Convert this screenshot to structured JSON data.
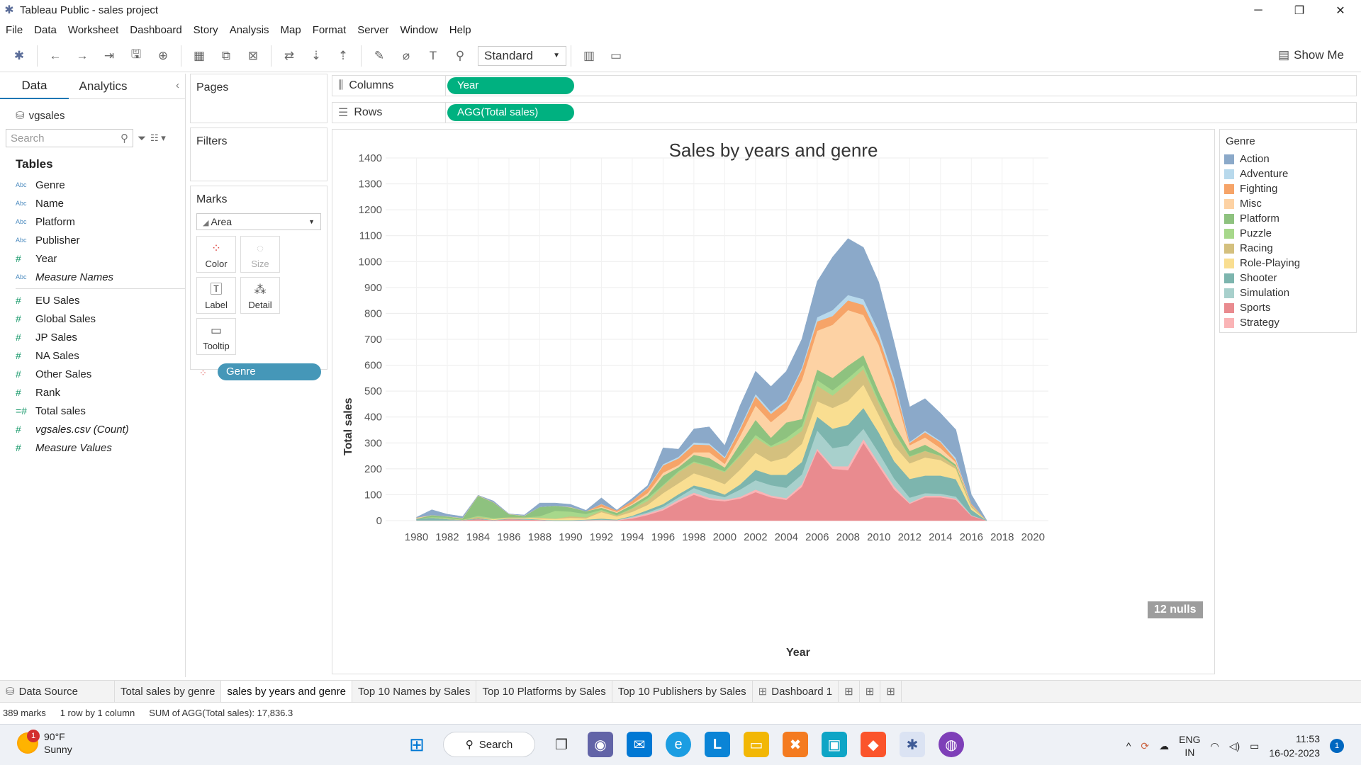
{
  "window": {
    "title": "Tableau Public - sales project"
  },
  "menu": [
    "File",
    "Data",
    "Worksheet",
    "Dashboard",
    "Story",
    "Analysis",
    "Map",
    "Format",
    "Server",
    "Window",
    "Help"
  ],
  "toolbar": {
    "fit_select": "Standard",
    "show_me": "Show Me"
  },
  "data_pane": {
    "tab_data": "Data",
    "tab_analytics": "Analytics",
    "datasource": "vgsales",
    "search_placeholder": "Search",
    "tables_title": "Tables",
    "dimensions": [
      {
        "type": "Abc",
        "name": "Genre",
        "italic": false
      },
      {
        "type": "Abc",
        "name": "Name",
        "italic": false
      },
      {
        "type": "Abc",
        "name": "Platform",
        "italic": false
      },
      {
        "type": "Abc",
        "name": "Publisher",
        "italic": false
      },
      {
        "type": "#",
        "name": "Year",
        "italic": false
      },
      {
        "type": "Abc",
        "name": "Measure Names",
        "italic": true
      }
    ],
    "measures": [
      {
        "type": "#",
        "name": "EU Sales",
        "italic": false
      },
      {
        "type": "#",
        "name": "Global Sales",
        "italic": false
      },
      {
        "type": "#",
        "name": "JP Sales",
        "italic": false
      },
      {
        "type": "#",
        "name": "NA Sales",
        "italic": false
      },
      {
        "type": "#",
        "name": "Other Sales",
        "italic": false
      },
      {
        "type": "#",
        "name": "Rank",
        "italic": false
      },
      {
        "type": "=#",
        "name": "Total sales",
        "italic": false
      },
      {
        "type": "#",
        "name": "vgsales.csv (Count)",
        "italic": true
      },
      {
        "type": "#",
        "name": "Measure Values",
        "italic": true
      }
    ]
  },
  "shelves": {
    "pages": "Pages",
    "filters": "Filters",
    "marks": "Marks",
    "mark_type": "Area",
    "mark_buttons": [
      "Color",
      "Size",
      "Label",
      "Detail",
      "Tooltip"
    ],
    "color_pill": "Genre",
    "columns_label": "Columns",
    "columns_pill": "Year",
    "rows_label": "Rows",
    "rows_pill": "AGG(Total sales)"
  },
  "chart_data": {
    "type": "area",
    "title": "Sales by years and genre",
    "xlabel": "Year",
    "ylabel": "Total sales",
    "xlim": [
      1978,
      2021
    ],
    "ylim": [
      0,
      1400
    ],
    "x_ticks": [
      1980,
      1982,
      1984,
      1986,
      1988,
      1990,
      1992,
      1994,
      1996,
      1998,
      2000,
      2002,
      2004,
      2006,
      2008,
      2010,
      2012,
      2014,
      2016,
      2018,
      2020
    ],
    "y_ticks": [
      0,
      100,
      200,
      300,
      400,
      500,
      600,
      700,
      800,
      900,
      1000,
      1100,
      1200,
      1300,
      1400
    ],
    "grid": true,
    "legend": "right",
    "stacked": true,
    "x": [
      1980,
      1981,
      1982,
      1983,
      1984,
      1985,
      1986,
      1987,
      1988,
      1989,
      1990,
      1991,
      1992,
      1993,
      1994,
      1995,
      1996,
      1997,
      1998,
      1999,
      2000,
      2001,
      2002,
      2003,
      2004,
      2005,
      2006,
      2007,
      2008,
      2009,
      2010,
      2011,
      2012,
      2013,
      2014,
      2015,
      2016,
      2017
    ],
    "series": [
      {
        "name": "Sports",
        "color": "#e98b8f",
        "values": [
          1,
          1,
          1,
          2,
          6,
          2,
          6,
          4,
          3,
          0,
          0,
          1,
          1,
          1,
          8,
          22,
          40,
          72,
          100,
          80,
          75,
          85,
          110,
          90,
          80,
          130,
          270,
          200,
          195,
          300,
          210,
          120,
          65,
          90,
          90,
          80,
          18,
          0
        ]
      },
      {
        "name": "Strategy",
        "color": "#fab4b6",
        "values": [
          0,
          0,
          0,
          0,
          0,
          0,
          0,
          0,
          0,
          0,
          0,
          1,
          1,
          1,
          4,
          6,
          6,
          8,
          8,
          8,
          6,
          7,
          10,
          7,
          7,
          10,
          8,
          10,
          15,
          15,
          12,
          12,
          4,
          6,
          6,
          5,
          2,
          0
        ]
      },
      {
        "name": "Simulation",
        "color": "#a8d0cc",
        "values": [
          0,
          0,
          0,
          0,
          0,
          0,
          0,
          1,
          0,
          0,
          0,
          0,
          2,
          0,
          4,
          4,
          8,
          10,
          18,
          16,
          10,
          28,
          36,
          40,
          40,
          38,
          70,
          70,
          80,
          40,
          40,
          30,
          20,
          10,
          8,
          8,
          2,
          0
        ]
      },
      {
        "name": "Shooter",
        "color": "#7db5ae",
        "values": [
          7,
          10,
          5,
          1,
          3,
          1,
          2,
          3,
          1,
          2,
          2,
          2,
          4,
          2,
          3,
          9,
          10,
          12,
          10,
          18,
          10,
          20,
          40,
          40,
          50,
          48,
          53,
          75,
          80,
          80,
          78,
          67,
          72,
          68,
          70,
          67,
          20,
          0
        ]
      },
      {
        "name": "Role-Playing",
        "color": "#f9de91",
        "values": [
          0,
          0,
          0,
          0,
          0,
          3,
          3,
          4,
          5,
          5,
          9,
          5,
          25,
          12,
          15,
          20,
          42,
          42,
          47,
          42,
          40,
          57,
          66,
          51,
          67,
          70,
          60,
          80,
          92,
          90,
          68,
          60,
          60,
          70,
          60,
          40,
          10,
          0
        ]
      },
      {
        "name": "Racing",
        "color": "#d4c07e",
        "values": [
          0,
          0,
          1,
          0,
          6,
          0,
          2,
          0,
          3,
          1,
          6,
          4,
          5,
          4,
          12,
          15,
          28,
          42,
          41,
          45,
          46,
          52,
          58,
          55,
          60,
          50,
          60,
          48,
          70,
          60,
          45,
          50,
          25,
          25,
          16,
          8,
          3,
          0
        ]
      },
      {
        "name": "Puzzle",
        "color": "#a7d88b",
        "values": [
          0,
          3,
          5,
          1,
          4,
          4,
          0,
          1,
          5,
          30,
          18,
          13,
          4,
          2,
          3,
          11,
          4,
          5,
          5,
          3,
          4,
          7,
          11,
          6,
          15,
          18,
          22,
          20,
          18,
          16,
          10,
          5,
          3,
          1,
          1,
          1,
          0,
          0
        ]
      },
      {
        "name": "Platform",
        "color": "#8ec27f",
        "values": [
          0,
          7,
          4,
          5,
          77,
          60,
          12,
          5,
          36,
          20,
          16,
          10,
          8,
          8,
          12,
          10,
          35,
          15,
          25,
          30,
          14,
          41,
          58,
          31,
          60,
          28,
          40,
          48,
          48,
          38,
          35,
          28,
          20,
          23,
          9,
          7,
          2,
          0
        ]
      },
      {
        "name": "Misc",
        "color": "#fdd2a4",
        "values": [
          3,
          1,
          1,
          2,
          2,
          0,
          1,
          1,
          0,
          0,
          2,
          0,
          4,
          4,
          4,
          10,
          12,
          8,
          10,
          22,
          14,
          30,
          55,
          60,
          50,
          150,
          150,
          205,
          215,
          155,
          180,
          130,
          22,
          28,
          20,
          9,
          3,
          0
        ]
      },
      {
        "name": "Fighting",
        "color": "#f6a468",
        "values": [
          1,
          0,
          0,
          0,
          0,
          1,
          0,
          0,
          0,
          0,
          0,
          0,
          10,
          5,
          12,
          18,
          28,
          26,
          30,
          28,
          22,
          26,
          36,
          32,
          30,
          40,
          36,
          34,
          37,
          39,
          30,
          30,
          9,
          20,
          23,
          8,
          5,
          0
        ]
      },
      {
        "name": "Adventure",
        "color": "#b8d9ec",
        "values": [
          0,
          0,
          0,
          0,
          0,
          0,
          0,
          1,
          0,
          0,
          0,
          0,
          1,
          0,
          0,
          3,
          5,
          6,
          8,
          6,
          5,
          8,
          9,
          9,
          8,
          8,
          16,
          23,
          21,
          22,
          22,
          17,
          4,
          6,
          5,
          9,
          1,
          0
        ]
      },
      {
        "name": "Action",
        "color": "#8ba9c9",
        "values": [
          1,
          20,
          8,
          5,
          0,
          5,
          0,
          2,
          15,
          10,
          10,
          4,
          23,
          2,
          9,
          8,
          63,
          30,
          52,
          64,
          44,
          84,
          88,
          97,
          110,
          110,
          138,
          205,
          218,
          200,
          190,
          137,
          135,
          124,
          107,
          109,
          35,
          1
        ]
      }
    ],
    "annotation": "12 nulls"
  },
  "sheet_tabs": {
    "data_source": "Data Source",
    "tabs": [
      "Total sales by genre",
      "sales by years and genre",
      "Top 10 Names by Sales",
      "Top 10 Platforms by Sales",
      "Top 10 Publishers by Sales",
      "Dashboard 1"
    ],
    "active_index": 1
  },
  "status": {
    "marks": "389 marks",
    "dims": "1 row by 1 column",
    "sum": "SUM of AGG(Total sales): 17,836.3"
  },
  "taskbar": {
    "weather_temp": "90°F",
    "weather_cond": "Sunny",
    "weather_badge": "1",
    "search": "Search",
    "lang": "ENG",
    "region": "IN",
    "time": "11:53",
    "date": "16-02-2023",
    "notif_count": "1"
  }
}
